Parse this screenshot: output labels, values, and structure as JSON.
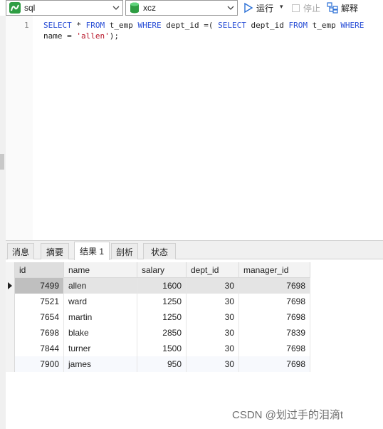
{
  "toolbar": {
    "connection": {
      "value": "sql",
      "icon": "connection-icon"
    },
    "database": {
      "value": "xcz",
      "icon": "database-icon"
    },
    "run_label": "运行",
    "run_dropdown": "▾",
    "stop_label": "停止",
    "explain_label": "解释"
  },
  "editor": {
    "line_number": "1",
    "keyword_color": "#2a4fd6",
    "string_color": "#b8172a",
    "tokens_line1": [
      {
        "t": "SELECT",
        "k": "kw"
      },
      {
        "t": " * ",
        "k": ""
      },
      {
        "t": "FROM",
        "k": "kw"
      },
      {
        "t": " t_emp ",
        "k": ""
      },
      {
        "t": "WHERE",
        "k": "kw"
      },
      {
        "t": " dept_id =( ",
        "k": ""
      },
      {
        "t": "SELECT",
        "k": "kw"
      },
      {
        "t": " dept_id ",
        "k": ""
      },
      {
        "t": "FROM",
        "k": "kw"
      },
      {
        "t": " t_emp ",
        "k": ""
      },
      {
        "t": "WHERE",
        "k": "kw"
      }
    ],
    "tokens_line2": [
      {
        "t": "name = ",
        "k": ""
      },
      {
        "t": "'allen'",
        "k": "str"
      },
      {
        "t": ");",
        "k": ""
      }
    ]
  },
  "tabs": [
    {
      "label": "消息",
      "active": false
    },
    {
      "label": "摘要",
      "active": false
    },
    {
      "label": "结果 1",
      "active": true
    },
    {
      "label": "剖析",
      "active": false
    },
    {
      "label": "状态",
      "active": false
    }
  ],
  "table": {
    "columns": [
      "id",
      "name",
      "salary",
      "dept_id",
      "manager_id"
    ],
    "rows": [
      [
        "7499",
        "allen",
        "1600",
        "30",
        "7698"
      ],
      [
        "7521",
        "ward",
        "1250",
        "30",
        "7698"
      ],
      [
        "7654",
        "martin",
        "1250",
        "30",
        "7698"
      ],
      [
        "7698",
        "blake",
        "2850",
        "30",
        "7839"
      ],
      [
        "7844",
        "turner",
        "1500",
        "30",
        "7698"
      ],
      [
        "7900",
        "james",
        "950",
        "30",
        "7698"
      ]
    ],
    "selected_row": 0
  },
  "watermark": "CSDN @划过手的泪滴t"
}
